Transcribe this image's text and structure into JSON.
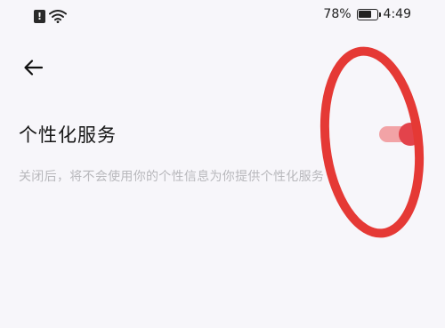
{
  "status_bar": {
    "sim_alert_glyph": "!",
    "battery_percent_text": "78%",
    "battery_level": 0.78,
    "time": "4:49",
    "icons": [
      "sim-alert-icon",
      "wifi-icon",
      "battery-icon"
    ]
  },
  "navigation": {
    "back_icon": "arrow-left-icon"
  },
  "setting": {
    "title": "个性化服务",
    "description": "关闭后，将不会使用你的个性信息为你提供个性化服务",
    "toggle_state": "on"
  },
  "colors": {
    "background": "#f7f6fa",
    "toggle_track": "#f2a3a6",
    "toggle_knob": "#e3434b",
    "annotation_circle": "#e53935",
    "description_text": "#b8b8bc"
  }
}
